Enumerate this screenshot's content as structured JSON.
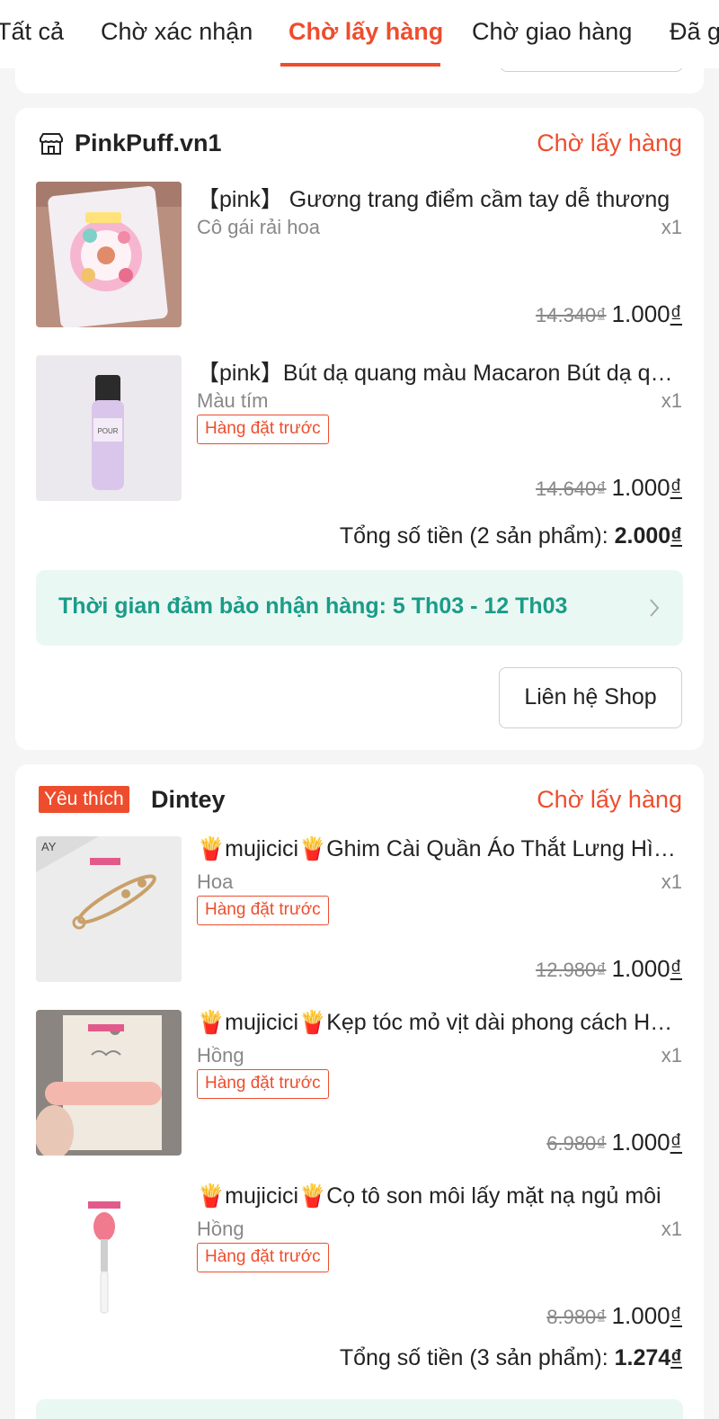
{
  "tabs": [
    {
      "label": "Tất cả"
    },
    {
      "label": "Chờ xác nhận"
    },
    {
      "label": "Chờ lấy hàng"
    },
    {
      "label": "Chờ giao hàng"
    },
    {
      "label": "Đã giao"
    }
  ],
  "active_tab": "Chờ lấy hàng",
  "orders": [
    {
      "shop_name": "PinkPuff.vn1",
      "status": "Chờ lấy hàng",
      "items": [
        {
          "title": "【pink】 Gương trang điểm cầm tay dễ thương",
          "variant": "Cô gái rải hoa",
          "qty": "x1",
          "old_price": "14.340₫",
          "price": "1.000",
          "currency": "₫"
        },
        {
          "title": "【pink】Bút dạ quang màu Macaron  Bút dạ quang",
          "variant": "Màu tím",
          "preorder": "Hàng đặt trước",
          "qty": "x1",
          "old_price": "14.640₫",
          "price": "1.000",
          "currency": "₫"
        }
      ],
      "total_label": "Tổng số tiền (2 sản phẩm): ",
      "total_value": "2.000",
      "guarantee": "Thời gian đảm bảo nhận hàng: 5 Th03 - 12 Th03",
      "contact_label": "Liên hệ Shop"
    },
    {
      "badge": "Yêu thích",
      "shop_name": "Dintey",
      "status": "Chờ lấy hàng",
      "items": [
        {
          "title": "🍟mujicici🍟Ghim Cài Quần Áo Thắt Lưng Hình Nơ",
          "variant": "Hoa",
          "preorder": "Hàng đặt trước",
          "qty": "x1",
          "old_price": "12.980₫",
          "price": "1.000",
          "currency": "₫"
        },
        {
          "title": "🍟mujicici🍟Kẹp tóc mỏ vịt dài phong cách Hàn Quốc",
          "variant": "Hồng",
          "preorder": "Hàng đặt trước",
          "qty": "x1",
          "old_price": "6.980₫",
          "price": "1.000",
          "currency": "₫"
        },
        {
          "title": "🍟mujicici🍟Cọ tô son môi lấy mặt nạ ngủ môi",
          "variant": "Hồng",
          "preorder": "Hàng đặt trước",
          "qty": "x1",
          "old_price": "8.980₫",
          "price": "1.000",
          "currency": "₫"
        }
      ],
      "total_label": "Tổng số tiền (3 sản phẩm): ",
      "total_value": "1.274"
    }
  ],
  "colors": {
    "accent": "#ee4d2d",
    "guarantee_text": "#1a9c88",
    "guarantee_bg": "#eaf8f4"
  }
}
